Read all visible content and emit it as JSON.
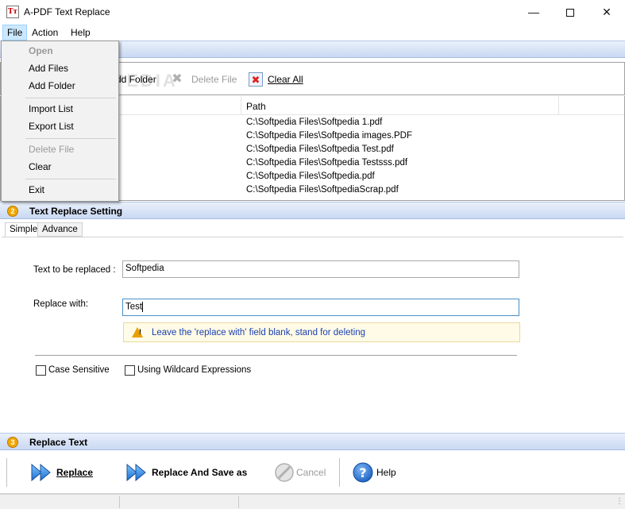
{
  "window": {
    "title": "A-PDF Text Replace",
    "icon_text": "Tт"
  },
  "menubar": {
    "file": "File",
    "action": "Action",
    "help": "Help"
  },
  "file_menu": {
    "items": [
      {
        "label": "Open",
        "enabled": false
      },
      {
        "label": "Add Files",
        "enabled": true
      },
      {
        "label": "Add Folder",
        "enabled": true
      },
      {
        "label": "Import List",
        "enabled": true
      },
      {
        "label": "Export List",
        "enabled": true
      },
      {
        "label": "Delete File",
        "enabled": false
      },
      {
        "label": "Clear",
        "enabled": true
      },
      {
        "label": "Exit",
        "enabled": true
      }
    ]
  },
  "section1": {
    "toolbar": {
      "add_folder": "dd Folder",
      "delete_file": "Delete File",
      "clear_all": "Clear All"
    },
    "watermark": "SOFTPEDIA",
    "list": {
      "column_path": "Path",
      "rows": [
        "C:\\Softpedia Files\\Softpedia 1.pdf",
        "C:\\Softpedia Files\\Softpedia images.PDF",
        "C:\\Softpedia Files\\Softpedia Test.pdf",
        "C:\\Softpedia Files\\Softpedia Testsss.pdf",
        "C:\\Softpedia Files\\Softpedia.pdf",
        "C:\\Softpedia Files\\SoftpediaScrap.pdf"
      ]
    }
  },
  "section2": {
    "number": "2",
    "title": "Text Replace Setting",
    "tabs": {
      "simple": "Simple",
      "advance": "Advance"
    },
    "text_to_replace_label": "Text to be replaced :",
    "text_to_replace_value": "Softpedia",
    "replace_with_label": "Replace with:",
    "replace_with_value": "Test",
    "hint": "Leave the 'replace with' field blank, stand for deleting",
    "case_sensitive": {
      "label": "Case Sensitive",
      "checked": false
    },
    "wildcard": {
      "label": "Using Wildcard Expressions",
      "checked": false
    }
  },
  "section3": {
    "number": "3",
    "title": "Replace Text",
    "replace": "Replace",
    "replace_save_as": "Replace And Save as",
    "cancel": "Cancel",
    "help": "Help"
  },
  "colors": {
    "accent_blue": "#1e7fd8",
    "section_header": "#c9d8f2",
    "warning": "#e8a000"
  }
}
